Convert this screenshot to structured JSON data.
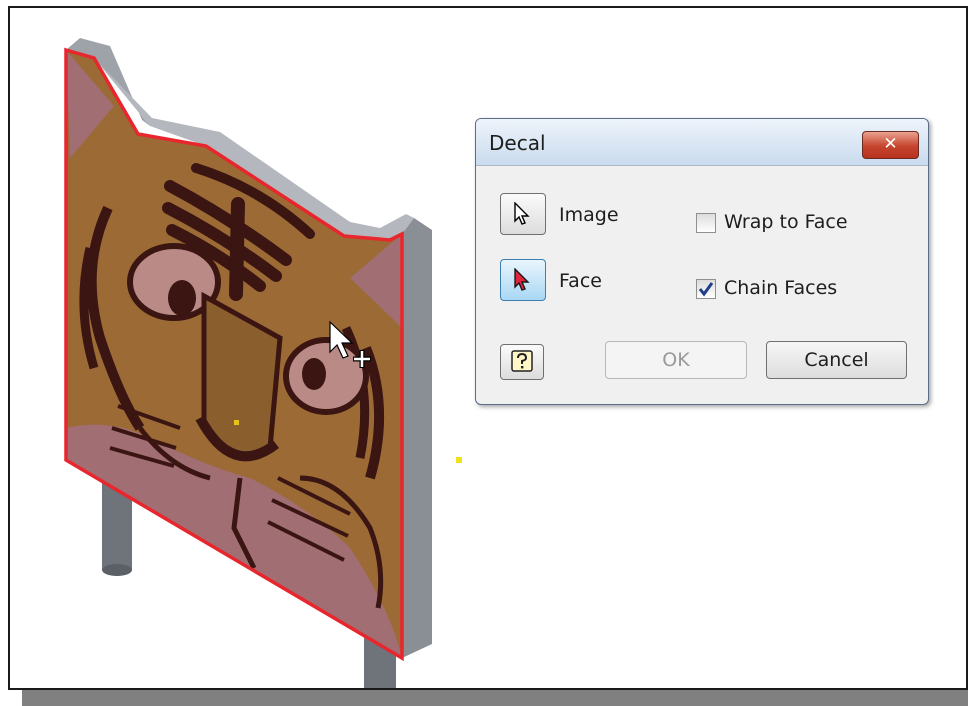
{
  "dialog": {
    "title": "Decal",
    "close_label": "x",
    "image_label": "Image",
    "face_label": "Face",
    "wrap_to_face_label": "Wrap to Face",
    "wrap_to_face_checked": false,
    "chain_faces_label": "Chain Faces",
    "chain_faces_checked": true,
    "ok_label": "OK",
    "ok_enabled": false,
    "cancel_label": "Cancel"
  },
  "colors": {
    "selection_outline": "#e8262d",
    "decal_fur": "#9c6a35",
    "decal_stripes": "#3a1512",
    "decal_face": "#a06e73",
    "board_edge": "#8a8f96",
    "post": "#6f747a",
    "title_bar": "#c9dbee",
    "close_button": "#c5442e",
    "active_button": "#a9d7f4"
  },
  "icons": [
    "select-arrow-icon",
    "face-select-arrow-icon",
    "help-icon",
    "close-icon",
    "checkmark-icon",
    "mouse-pointer-icon",
    "crosshair-icon"
  ]
}
